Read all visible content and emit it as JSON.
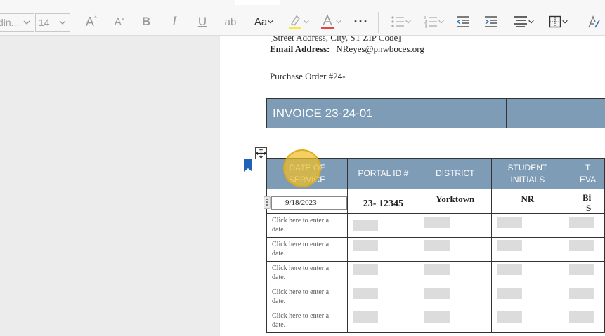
{
  "toolbar": {
    "font_name": "din...",
    "font_size": "14",
    "buttons": {
      "grow_font": "A",
      "shrink_font": "A",
      "bold": "B",
      "italic": "I",
      "underline": "U",
      "strikethrough": "ab",
      "change_case": "Aa",
      "more": "···"
    },
    "colors": {
      "highlight": "#f5e94a",
      "font_color": "#e04848",
      "accent_icon": "#6a6a6a"
    }
  },
  "document": {
    "address_line": "[Street Address, City, ST ZIP Code]",
    "email_label": "Email Address:",
    "email_value": "NReyes@pnwboces.org",
    "po_label": "Purchase Order #24-",
    "invoice_title": "INVOICE 23-24-01",
    "table": {
      "headers": [
        {
          "line1": "DATE OF",
          "line2": "SERVICE"
        },
        {
          "line1": "PORTAL ID #",
          "line2": ""
        },
        {
          "line1": "DISTRICT",
          "line2": ""
        },
        {
          "line1": "STUDENT",
          "line2": "INITIALS"
        },
        {
          "line1": "T",
          "line2": "EVA"
        }
      ],
      "first_row": {
        "date": "9/18/2023",
        "portal_id": "23- 12345",
        "district": "Yorktown",
        "initials": "NR",
        "cut_line1": "Bi",
        "cut_line2": "S"
      },
      "date_placeholder": "Click here to enter a date.",
      "empty_rows": 5
    }
  },
  "colors": {
    "header_bg": "#7f9cb6",
    "page_bg": "#ffffff",
    "workspace_bg": "#ececec",
    "cursor_highlight": "#f0be28"
  }
}
